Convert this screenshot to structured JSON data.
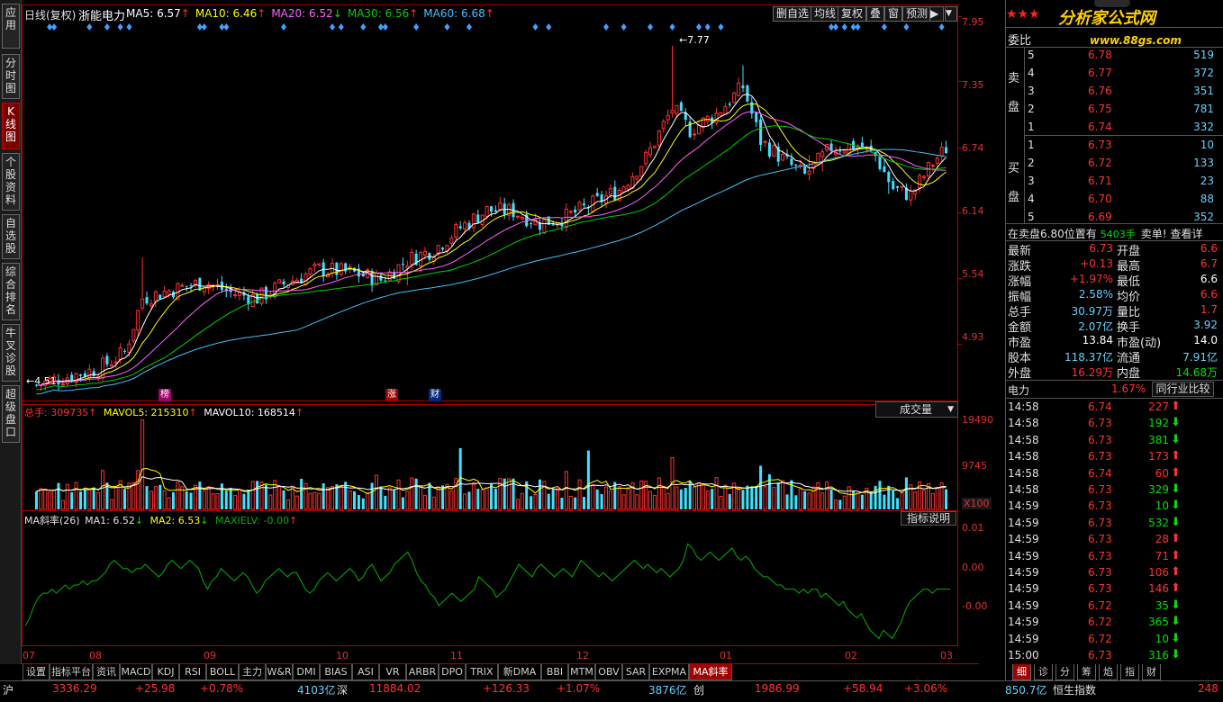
{
  "chart_data": {
    "type": "candlestick",
    "title": "日线(复权)",
    "stock_name": "浙能电力",
    "ma": [
      {
        "name": "MA5",
        "value": "6.57",
        "color": "#ffffff"
      },
      {
        "name": "MA10",
        "value": "6.46",
        "color": "#ffff00"
      },
      {
        "name": "MA20",
        "value": "6.52",
        "color": "#ff60ff"
      },
      {
        "name": "MA30",
        "value": "6.56",
        "color": "#00d000"
      },
      {
        "name": "MA60",
        "value": "6.68",
        "color": "#40c0ff"
      }
    ],
    "y_ticks": [
      "7.95",
      "7.35",
      "6.74",
      "6.14",
      "5.54",
      "4.93"
    ],
    "y_range": [
      4.4,
      7.95
    ],
    "x_ticks": [
      "07",
      "09",
      "08",
      "10",
      "11",
      "12",
      "01",
      "02",
      "03"
    ],
    "x_months": [
      "07",
      "08",
      "09",
      "10",
      "11",
      "12",
      "01",
      "02",
      "03"
    ],
    "month_bar_index": [
      0,
      17,
      42,
      72,
      98,
      125,
      155,
      183,
      203
    ],
    "high_label": "7.77",
    "low_label": "4.51",
    "flags": [
      "榜",
      "涨",
      "财"
    ],
    "anchors": [
      [
        0,
        4.55
      ],
      [
        6,
        4.62
      ],
      [
        14,
        4.7
      ],
      [
        20,
        4.85
      ],
      [
        24,
        5.35
      ],
      [
        30,
        5.42
      ],
      [
        38,
        5.5
      ],
      [
        44,
        5.4
      ],
      [
        50,
        5.35
      ],
      [
        56,
        5.48
      ],
      [
        64,
        5.62
      ],
      [
        72,
        5.58
      ],
      [
        78,
        5.52
      ],
      [
        84,
        5.7
      ],
      [
        90,
        5.8
      ],
      [
        96,
        6.0
      ],
      [
        102,
        6.16
      ],
      [
        108,
        6.15
      ],
      [
        114,
        6.04
      ],
      [
        120,
        6.1
      ],
      [
        126,
        6.22
      ],
      [
        132,
        6.35
      ],
      [
        138,
        6.64
      ],
      [
        144,
        7.1
      ],
      [
        148,
        6.9
      ],
      [
        154,
        7.05
      ],
      [
        160,
        7.3
      ],
      [
        164,
        6.8
      ],
      [
        170,
        6.6
      ],
      [
        174,
        6.48
      ],
      [
        180,
        6.74
      ],
      [
        186,
        6.76
      ],
      [
        190,
        6.66
      ],
      [
        194,
        6.36
      ],
      [
        198,
        6.3
      ],
      [
        203,
        6.6
      ],
      [
        206,
        6.73
      ]
    ],
    "seed": 7,
    "volume": {
      "total_label": "总手: 309735",
      "mavol5_label": "MAVOL5: 215310",
      "mavol10_label": "MAVOL10: 168514",
      "dropdown": "成交量",
      "y_ticks": [
        "19490",
        "9745"
      ],
      "unit": "X100",
      "max": 19490
    },
    "indicator": {
      "name_label": "MA斜率(26)",
      "ma1_label": "MA1: 6.52",
      "ma2_label": "MA2: 6.53",
      "maxielv_label": "MAXIELV: -0.00",
      "explain_button": "指标说明",
      "y_ticks": [
        "0.01",
        "0.00",
        "-0.00"
      ],
      "range": [
        -0.014,
        0.014
      ],
      "values": [
        -0.01,
        -0.008,
        -0.005,
        -0.003,
        -0.002,
        -0.002,
        -0.001,
        -0.002,
        -0.001,
        0.0,
        -0.001,
        0.0,
        0.0,
        0.001,
        0.0,
        0.001,
        0.001,
        0.002,
        0.003,
        0.005,
        0.006,
        0.005,
        0.004,
        0.004,
        0.003,
        0.004,
        0.004,
        0.005,
        0.004,
        0.003,
        0.002,
        0.003,
        0.005,
        0.006,
        0.005,
        0.004,
        0.005,
        0.006,
        0.005,
        0.004,
        0.001,
        -0.001,
        0.001,
        0.002,
        0.004,
        0.003,
        0.002,
        0.001,
        0.002,
        0.003,
        0.002,
        0.0,
        -0.002,
        -0.001,
        0.001,
        0.002,
        0.003,
        0.004,
        0.003,
        0.002,
        0.003,
        0.003,
        0.001,
        -0.001,
        -0.002,
        -0.001,
        0.001,
        0.002,
        0.003,
        0.002,
        0.001,
        0.002,
        0.003,
        0.004,
        0.003,
        0.001,
        0.002,
        0.004,
        0.005,
        0.003,
        0.001,
        0.002,
        0.003,
        0.005,
        0.006,
        0.007,
        0.008,
        0.006,
        0.003,
        0.001,
        0.0,
        -0.002,
        -0.003,
        -0.005,
        -0.004,
        -0.003,
        -0.002,
        -0.003,
        -0.004,
        -0.003,
        -0.002,
        -0.001,
        0.002,
        0.001,
        0.0,
        -0.001,
        -0.003,
        -0.002,
        -0.001,
        0.001,
        0.003,
        0.005,
        0.004,
        0.003,
        0.002,
        0.004,
        0.005,
        0.004,
        0.003,
        0.002,
        0.003,
        0.004,
        0.003,
        0.002,
        0.004,
        0.006,
        0.005,
        0.004,
        0.003,
        0.002,
        0.003,
        0.002,
        0.001,
        0.002,
        0.003,
        0.004,
        0.005,
        0.006,
        0.005,
        0.004,
        0.005,
        0.004,
        0.003,
        0.004,
        0.003,
        0.002,
        0.003,
        0.004,
        0.006,
        0.01,
        0.009,
        0.007,
        0.006,
        0.007,
        0.008,
        0.007,
        0.006,
        0.007,
        0.008,
        0.009,
        0.007,
        0.006,
        0.007,
        0.006,
        0.004,
        0.003,
        0.002,
        0.002,
        0.001,
        0.0,
        0.0,
        -0.001,
        -0.001,
        -0.001,
        -0.002,
        -0.001,
        -0.002,
        -0.001,
        -0.001,
        -0.003,
        -0.002,
        -0.003,
        -0.004,
        -0.005,
        -0.004,
        -0.006,
        -0.007,
        -0.008,
        -0.007,
        -0.009,
        -0.011,
        -0.012,
        -0.013,
        -0.011,
        -0.012,
        -0.013,
        -0.011,
        -0.009,
        -0.006,
        -0.004,
        -0.003,
        -0.002,
        -0.001,
        -0.001,
        -0.002,
        -0.001,
        -0.001,
        -0.001,
        -0.001
      ]
    }
  },
  "left_tabs": [
    "应用",
    "分时图",
    "K线图",
    "个股资料",
    "自选股",
    "综合排名",
    "牛叉诊股",
    "超级盘口"
  ],
  "left_active": 2,
  "toolbar": [
    "删自选",
    "均线",
    "复权",
    "叠",
    "窗",
    "预测"
  ],
  "bottom_tabs": [
    "设置",
    "指标平台",
    "资讯",
    "MACD",
    "KDJ",
    "RSI",
    "BOLL",
    "主力",
    "W&R",
    "DMI",
    "BIAS",
    "ASI",
    "VR",
    "ARBR",
    "DPO",
    "TRIX",
    "新DMA",
    "BBI",
    "MTM",
    "OBV",
    "SAR",
    "EXPMA",
    "MA斜率"
  ],
  "bottom_active": 22,
  "logo": {
    "main": "分析家公式网",
    "url": "www.88gs.com",
    "stars": "★★★"
  },
  "order_book": {
    "header": "委比",
    "sell_label": [
      "卖",
      "盘"
    ],
    "buy_label": [
      "买",
      "盘"
    ],
    "sell": [
      [
        "5",
        "6.78",
        "519"
      ],
      [
        "4",
        "6.77",
        "372"
      ],
      [
        "3",
        "6.76",
        "351"
      ],
      [
        "2",
        "6.75",
        "781"
      ],
      [
        "1",
        "6.74",
        "332"
      ]
    ],
    "buy": [
      [
        "1",
        "6.73",
        "10"
      ],
      [
        "2",
        "6.72",
        "133"
      ],
      [
        "3",
        "6.71",
        "23"
      ],
      [
        "4",
        "6.70",
        "88"
      ],
      [
        "5",
        "6.69",
        "352"
      ]
    ],
    "note_left": "在卖盘6.80位置有",
    "note_mid": "5403手",
    "note_right": "卖单! 查看详",
    "colors": {
      "up": "#ff3030",
      "down": "#00e000",
      "vol": "#60d0ff"
    }
  },
  "quote": [
    {
      "l": "最新",
      "v": "6.73",
      "vc": "#ff3030",
      "l2": "开盘",
      "v2": "6.6",
      "v2c": "#ff3030"
    },
    {
      "l": "涨跌",
      "v": "+0.13",
      "vc": "#ff3030",
      "l2": "最高",
      "v2": "6.7",
      "v2c": "#ff3030"
    },
    {
      "l": "涨幅",
      "v": "+1.97%",
      "vc": "#ff3030",
      "l2": "最低",
      "v2": "6.6",
      "v2c": "#ffffff"
    },
    {
      "l": "振幅",
      "v": "2.58%",
      "vc": "#60d0ff",
      "l2": "均价",
      "v2": "6.6",
      "v2c": "#ff3030"
    },
    {
      "l": "总手",
      "v": "30.97万",
      "vc": "#60d0ff",
      "l2": "量比",
      "v2": "1.7",
      "v2c": "#ff3030"
    },
    {
      "l": "金额",
      "v": "2.07亿",
      "vc": "#60d0ff",
      "l2": "换手",
      "v2": "3.92",
      "v2c": "#60d0ff"
    },
    {
      "l": "市盈",
      "v": "13.84",
      "vc": "#ffffff",
      "l2": "市盈(动)",
      "v2": "14.0",
      "v2c": "#ffffff"
    },
    {
      "l": "股本",
      "v": "118.37亿",
      "vc": "#60d0ff",
      "l2": "流通",
      "v2": "7.91亿",
      "v2c": "#60d0ff"
    },
    {
      "l": "外盘",
      "v": "16.29万",
      "vc": "#ff3030",
      "l2": "内盘",
      "v2": "14.68万",
      "v2c": "#00e000"
    }
  ],
  "industry": {
    "name": "电力",
    "pct": "1.67%",
    "button": "同行业比较"
  },
  "ticks": [
    [
      "14:58",
      "6.74",
      "227",
      "up"
    ],
    [
      "14:58",
      "6.73",
      "192",
      "down"
    ],
    [
      "14:58",
      "6.73",
      "381",
      "down"
    ],
    [
      "14:58",
      "6.73",
      "173",
      "up"
    ],
    [
      "14:58",
      "6.74",
      "60",
      "up"
    ],
    [
      "14:58",
      "6.73",
      "329",
      "down"
    ],
    [
      "14:59",
      "6.73",
      "10",
      "down"
    ],
    [
      "14:59",
      "6.73",
      "532",
      "down"
    ],
    [
      "14:59",
      "6.73",
      "28",
      "up"
    ],
    [
      "14:59",
      "6.73",
      "71",
      "up"
    ],
    [
      "14:59",
      "6.73",
      "106",
      "up"
    ],
    [
      "14:59",
      "6.73",
      "146",
      "up"
    ],
    [
      "14:59",
      "6.72",
      "35",
      "down"
    ],
    [
      "14:59",
      "6.72",
      "365",
      "down"
    ],
    [
      "14:59",
      "6.72",
      "10",
      "down"
    ],
    [
      "15:00",
      "6.73",
      "316",
      "down"
    ]
  ],
  "corner_tabs": [
    "细",
    "诊",
    "分",
    "筹",
    "焰",
    "指",
    "财"
  ],
  "corner_active": 0,
  "status_bar": {
    "sh_label": "沪",
    "sh_index": "3336.29",
    "sh_chg": "+25.98",
    "sh_pct": "+0.78%",
    "sh_amt": "4103亿",
    "sz_label": "深",
    "sz_index": "11884.02",
    "sz_chg": "+126.33",
    "sz_pct": "+1.07%",
    "sz_amt": "3876亿",
    "cy_label": "创",
    "cy_index": "1986.99",
    "cy_chg": "+58.94",
    "cy_pct": "+3.06%",
    "cy_amt": "850.7亿",
    "hk_label": "恒生指数",
    "hk_index": "248"
  }
}
